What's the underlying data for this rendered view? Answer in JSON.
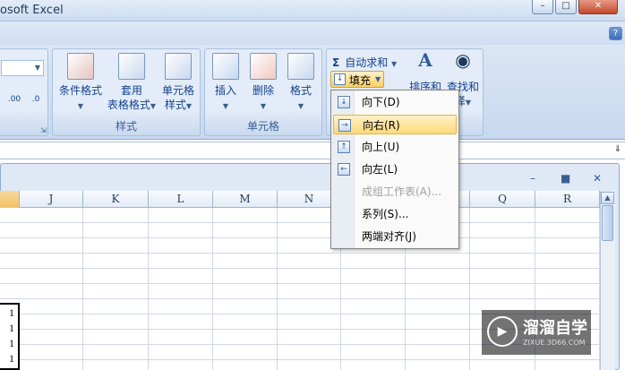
{
  "window": {
    "title": "osoft Excel",
    "minimize": "–",
    "restore": "□",
    "close": "✕"
  },
  "help": "?",
  "ribbon": {
    "styles_group": {
      "label": "样式",
      "conditional": "条件格式",
      "table_fmt_1": "套用",
      "table_fmt_2": "表格格式",
      "cell_style_1": "单元格",
      "cell_style_2": "样式"
    },
    "cells_group": {
      "label": "单元格",
      "insert": "插入",
      "delete": "删除",
      "format": "格式"
    },
    "editing": {
      "autosum": "自动求和",
      "sigma": "Σ",
      "fill": "填充",
      "sort_partial": "排序和",
      "find_partial": "查找和",
      "find_partial2": "择"
    },
    "number": {
      "inc": ".00",
      "dec": ".0"
    }
  },
  "fill_menu": [
    {
      "label": "向下(D)",
      "icon": "arrow-down-icon",
      "glyph": "↓",
      "disabled": false,
      "highlight": false
    },
    {
      "label": "向右(R)",
      "icon": "arrow-right-icon",
      "glyph": "→",
      "disabled": false,
      "highlight": true
    },
    {
      "label": "向上(U)",
      "icon": "arrow-up-icon",
      "glyph": "↑",
      "disabled": false,
      "highlight": false
    },
    {
      "label": "向左(L)",
      "icon": "arrow-left-icon",
      "glyph": "←",
      "disabled": false,
      "highlight": false
    },
    {
      "label": "成组工作表(A)...",
      "icon": "",
      "glyph": "",
      "disabled": true,
      "highlight": false
    },
    {
      "label": "系列(S)...",
      "icon": "",
      "glyph": "",
      "disabled": false,
      "highlight": false
    },
    {
      "label": "两端对齐(J)",
      "icon": "",
      "glyph": "",
      "disabled": false,
      "highlight": false
    }
  ],
  "columns": [
    "J",
    "K",
    "L",
    "M",
    "N",
    "O",
    "P",
    "Q",
    "R"
  ],
  "cells": [
    "1",
    "1",
    "1",
    "1"
  ],
  "watermark": {
    "logo": "▶",
    "name": "溜溜自学",
    "url": "ZIXUE.3D66.COM"
  },
  "colors": {
    "highlight": "#fed97a",
    "ribbon": "#dbe6f5",
    "accent": "#15428b"
  }
}
